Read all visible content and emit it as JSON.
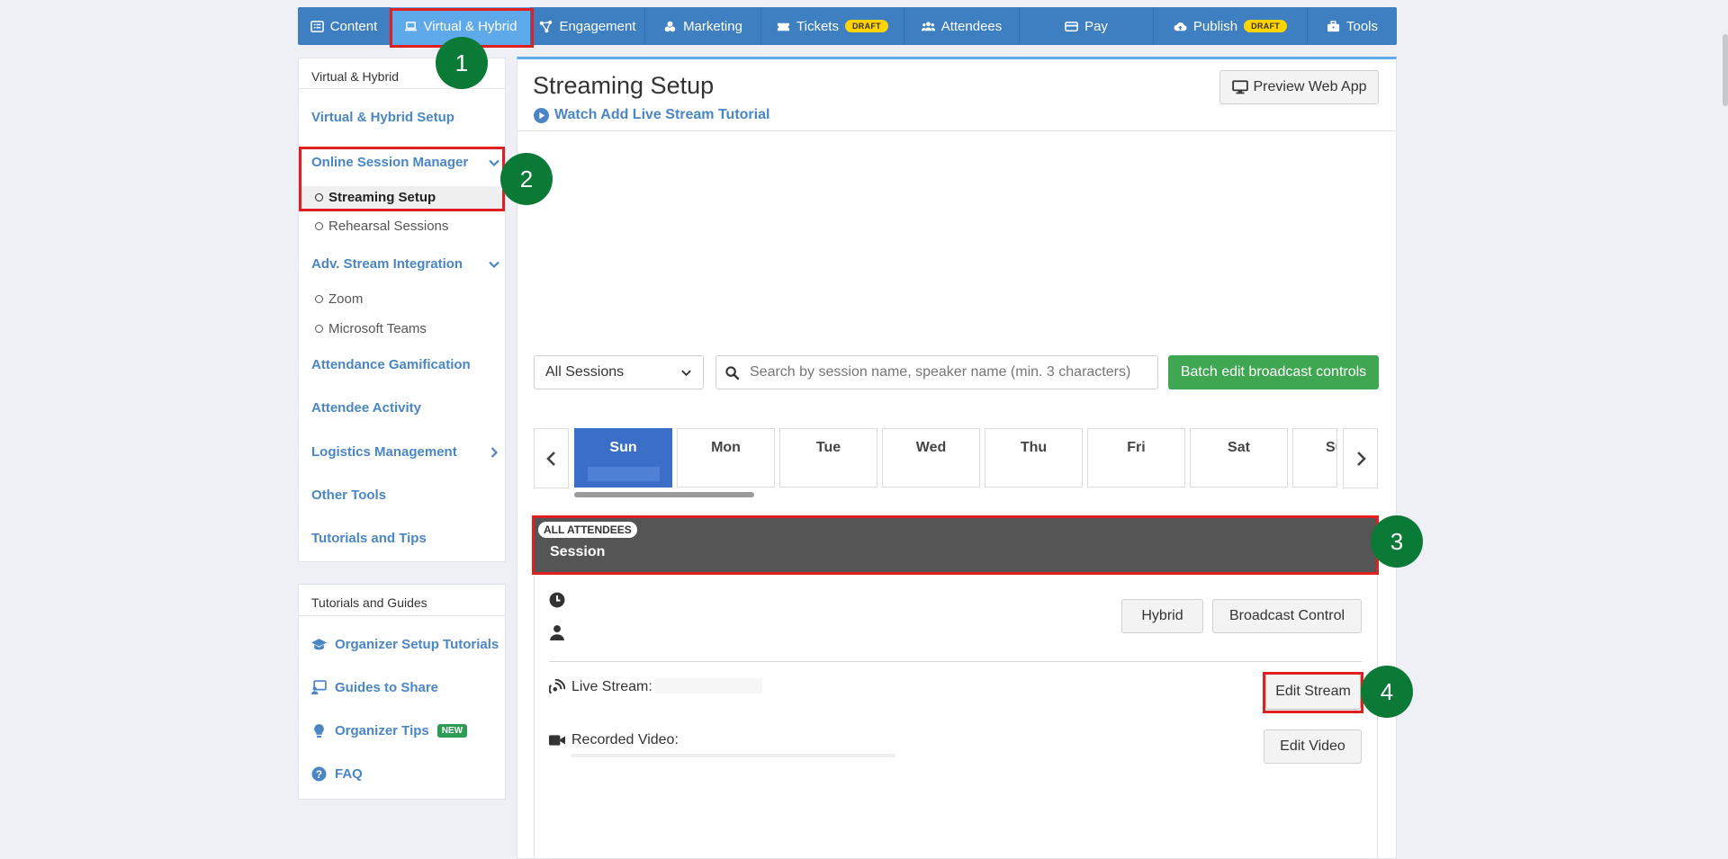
{
  "nav": {
    "items": [
      {
        "label": "Content",
        "icon": "list-icon"
      },
      {
        "label": "Virtual & Hybrid",
        "icon": "laptop-icon",
        "active": true
      },
      {
        "label": "Engagement",
        "icon": "share-nodes-icon"
      },
      {
        "label": "Marketing",
        "icon": "megaphone-icon"
      },
      {
        "label": "Tickets",
        "icon": "ticket-icon",
        "badge": "DRAFT"
      },
      {
        "label": "Attendees",
        "icon": "users-icon"
      },
      {
        "label": "Pay",
        "icon": "credit-card-icon"
      },
      {
        "label": "Publish",
        "icon": "cloud-upload-icon",
        "badge": "DRAFT"
      },
      {
        "label": "Tools",
        "icon": "toolbox-icon"
      }
    ]
  },
  "sidebar": {
    "header": "Virtual & Hybrid",
    "items": {
      "setup": "Virtual & Hybrid Setup",
      "osm": "Online Session Manager",
      "streaming": "Streaming Setup",
      "rehearsal": "Rehearsal Sessions",
      "adv": "Adv. Stream Integration",
      "zoom": "Zoom",
      "teams": "Microsoft Teams",
      "gamification": "Attendance Gamification",
      "activity": "Attendee Activity",
      "logistics": "Logistics Management",
      "other": "Other Tools",
      "tutorials": "Tutorials and Tips"
    }
  },
  "guides": {
    "header": "Tutorials and Guides",
    "items": {
      "organizer_setup": "Organizer Setup Tutorials",
      "share": "Guides to Share",
      "tips": "Organizer Tips",
      "tips_badge": "NEW",
      "faq": "FAQ"
    }
  },
  "main": {
    "title": "Streaming Setup",
    "tutorial_link": "Watch Add Live Stream Tutorial",
    "preview_button": "Preview Web App",
    "filter": {
      "selected": "All Sessions"
    },
    "search_placeholder": "Search by session name, speaker name (min. 3 characters)",
    "batch_button": "Batch edit broadcast controls",
    "days": [
      "Sun",
      "Mon",
      "Tue",
      "Wed",
      "Thu",
      "Fri",
      "Sat",
      "Su"
    ],
    "session": {
      "badge": "ALL ATTENDEES",
      "title": "Session",
      "hybrid_button": "Hybrid",
      "broadcast_button": "Broadcast Control",
      "live_stream_label": "Live Stream:",
      "edit_stream_button": "Edit Stream",
      "recorded_label": "Recorded Video:",
      "edit_video_button": "Edit Video"
    }
  },
  "annotations": [
    "1",
    "2",
    "3",
    "4"
  ],
  "colors": {
    "nav_bg": "#3d7fc1",
    "nav_active": "#5ea9ea",
    "link": "#4a86c5",
    "marker": "#0b7a36",
    "highlight": "#e02020",
    "batch_green": "#3fa652",
    "day_active": "#3a6ec7"
  }
}
